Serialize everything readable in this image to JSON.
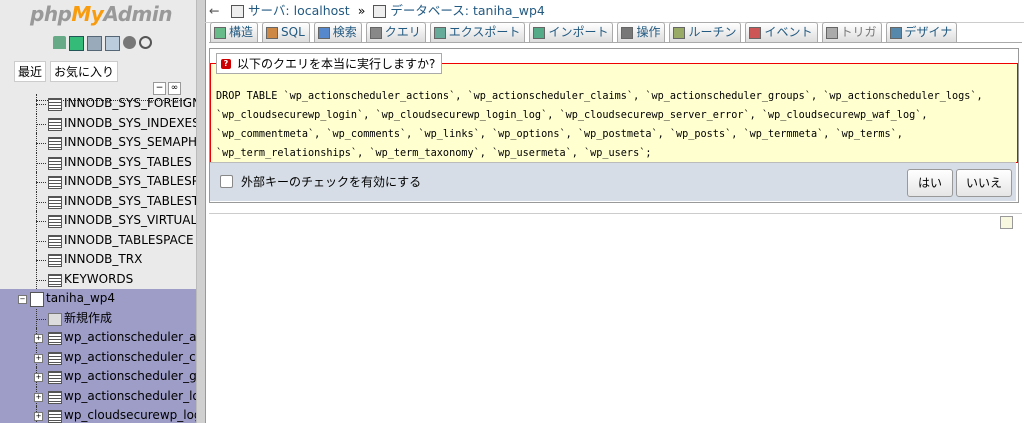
{
  "sidebar": {
    "logo_php": "php",
    "logo_my": "My",
    "logo_admin": "Admin",
    "fav_tabs": [
      "最近",
      "お気に入り"
    ],
    "tables_above": [
      "INNODB_SYS_FOREIGN",
      "INNODB_SYS_INDEXES",
      "INNODB_SYS_SEMAPH",
      "INNODB_SYS_TABLES",
      "INNODB_SYS_TABLESP",
      "INNODB_SYS_TABLEST",
      "INNODB_SYS_VIRTUAL",
      "INNODB_TABLESPACE",
      "INNODB_TRX",
      "KEYWORDS"
    ],
    "database": "taniha_wp4",
    "new_label": "新規作成",
    "db_tables": [
      "wp_actionscheduler_ac",
      "wp_actionscheduler_cla",
      "wp_actionscheduler_gr",
      "wp_actionscheduler_lo",
      "wp_cloudsecurewp_logi"
    ]
  },
  "breadcrumb": {
    "back": "←",
    "server_label": "サーバ:",
    "server": "localhost",
    "sep": "»",
    "db_label": "データベース:",
    "db": "taniha_wp4"
  },
  "tabs": [
    {
      "label": "構造",
      "icon": "structure-icon"
    },
    {
      "label": "SQL",
      "icon": "sql-icon"
    },
    {
      "label": "検索",
      "icon": "search-icon"
    },
    {
      "label": "クエリ",
      "icon": "query-icon"
    },
    {
      "label": "エクスポート",
      "icon": "export-icon"
    },
    {
      "label": "インポート",
      "icon": "import-icon"
    },
    {
      "label": "操作",
      "icon": "operations-icon"
    },
    {
      "label": "ルーチン",
      "icon": "routines-icon"
    },
    {
      "label": "イベント",
      "icon": "events-icon"
    },
    {
      "label": "トリガ",
      "icon": "triggers-icon",
      "disabled": true
    },
    {
      "label": "デザイナ",
      "icon": "designer-icon"
    }
  ],
  "confirm": {
    "question": "以下のクエリを本当に実行しますか?",
    "sql": "DROP TABLE `wp_actionscheduler_actions`, `wp_actionscheduler_claims`, `wp_actionscheduler_groups`, `wp_actionscheduler_logs`, `wp_cloudsecurewp_login`, `wp_cloudsecurewp_login_log`, `wp_cloudsecurewp_server_error`, `wp_cloudsecurewp_waf_log`, `wp_commentmeta`, `wp_comments`, `wp_links`, `wp_options`, `wp_postmeta`, `wp_posts`, `wp_termmeta`, `wp_terms`, `wp_term_relationships`, `wp_term_taxonomy`, `wp_usermeta`, `wp_users`;",
    "fk_checkbox_label": "外部キーのチェックを有効にする",
    "fk_checked": false,
    "yes_label": "はい",
    "no_label": "いいえ"
  },
  "colors": {
    "accent_link": "#235a81",
    "error_bg": "#ffffd0",
    "error_border": "#ee0000",
    "selected_tree": "#9d9dc8"
  }
}
